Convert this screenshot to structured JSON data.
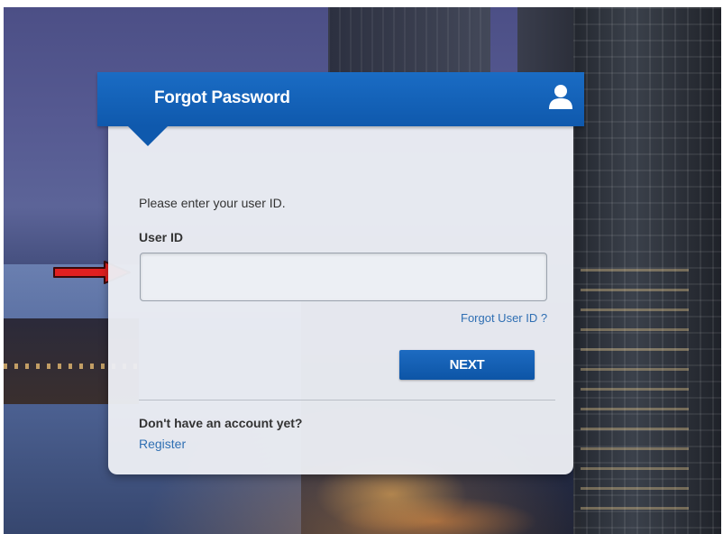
{
  "header": {
    "title": "Forgot Password",
    "icon": "user-icon"
  },
  "form": {
    "instruction": "Please enter your user ID.",
    "user_id_label": "User ID",
    "user_id_value": "",
    "forgot_user_id_link": "Forgot User ID ?",
    "next_button": "NEXT"
  },
  "footer": {
    "no_account_text": "Don't have an account yet?",
    "register_link": "Register"
  },
  "annotation": {
    "icon": "red-arrow-icon",
    "color": "#e02020"
  },
  "colors": {
    "brand_blue": "#1565c0",
    "link_blue": "#2f6fb3"
  }
}
